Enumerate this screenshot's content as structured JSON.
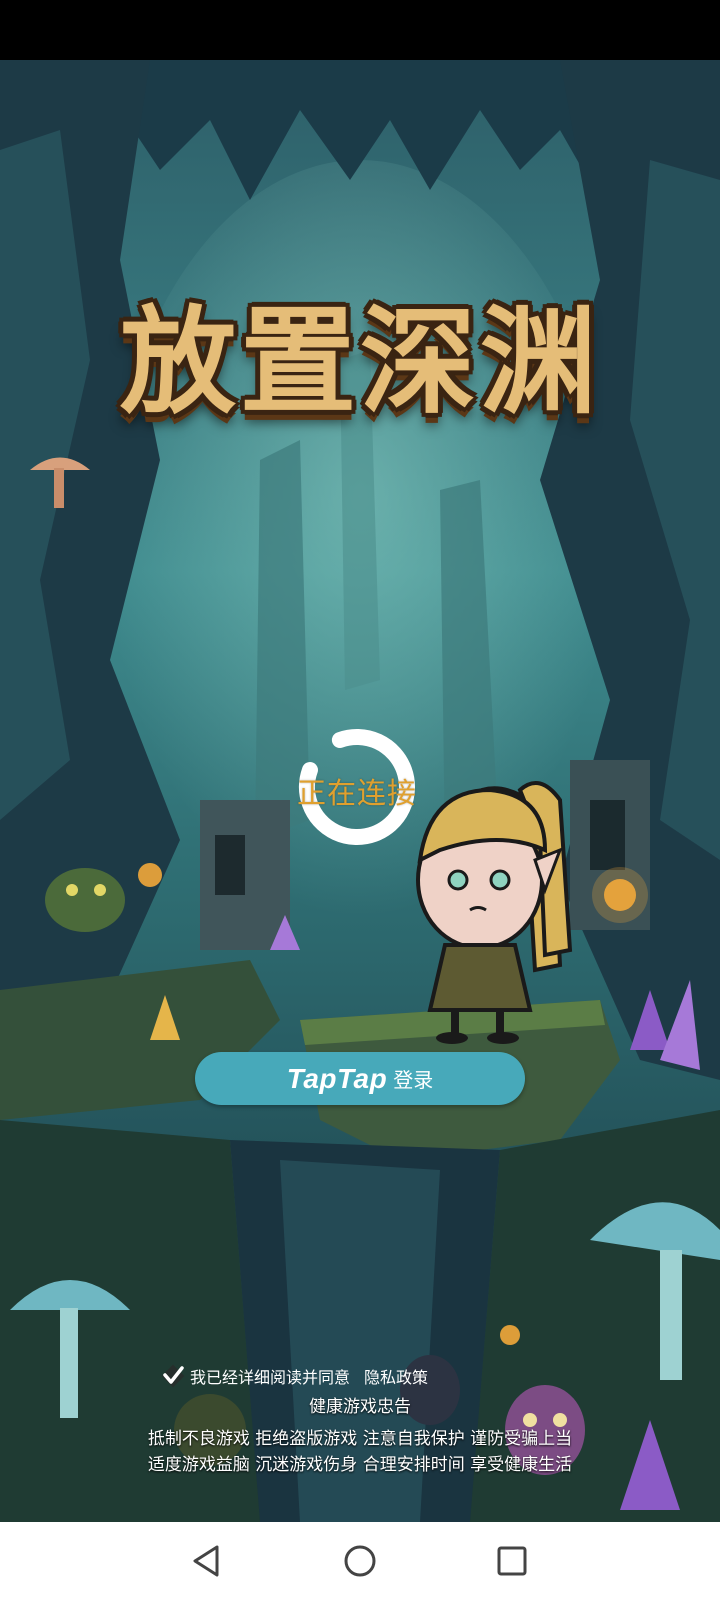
{
  "game": {
    "title": "放置深渊"
  },
  "loading": {
    "text": "正在连接"
  },
  "login": {
    "brand": "TapTap",
    "label": "登录"
  },
  "agreement": {
    "text": "我已经详细阅读并同意",
    "link": "隐私政策",
    "checked": true
  },
  "health_notice": {
    "title": "健康游戏忠告",
    "line1": "抵制不良游戏 拒绝盗版游戏 注意自我保护 谨防受骗上当",
    "line2": "适度游戏益脑 沉迷游戏伤身 合理安排时间 享受健康生活"
  },
  "navigation": {
    "back_icon": "triangle-back-icon",
    "home_icon": "circle-home-icon",
    "recents_icon": "square-recents-icon"
  },
  "colors": {
    "title": "#e5bd78",
    "loading_text": "#e0a02e",
    "button": "#47a9ba"
  }
}
